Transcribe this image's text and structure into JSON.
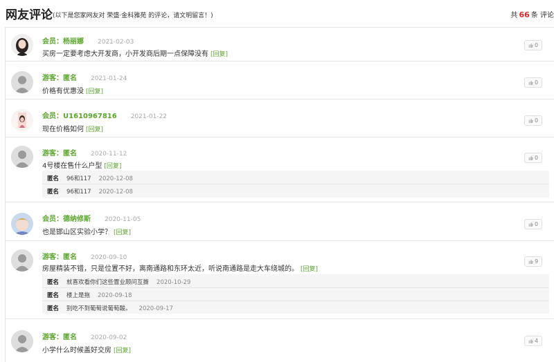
{
  "header": {
    "title": "网友评论",
    "subtitle": "(以下是您家网友对 荣盛·金科雅苑 的评论，请文明留言！)",
    "total_prefix": "共",
    "total_count": "66",
    "total_suffix": "条 评论"
  },
  "comments": [
    {
      "role": "会员：",
      "name": "杨丽娜",
      "date": "2021-02-03",
      "text": "买房一定要考虑大开发商，小开发商后期一点保障没有",
      "reply_label": "[回复]",
      "likes": "0",
      "avatar": "photo-female-avatar"
    },
    {
      "role": "游客：",
      "name": "匿名",
      "date": "2021-01-24",
      "text": "价格有优惠没",
      "reply_label": "[回复]",
      "likes": "0",
      "avatar": "default-user-avatar"
    },
    {
      "role": "会员：",
      "name": "U1610967816",
      "date": "2021-01-22",
      "text": "现在价格如何",
      "reply_label": "[回复]",
      "likes": "0",
      "avatar": "photo-avatar"
    },
    {
      "role": "游客：",
      "name": "匿名",
      "date": "2020-11-12",
      "text": "4号楼在售什么户型",
      "reply_label": "[回复]",
      "likes": "0",
      "avatar": "default-user-avatar",
      "replies": [
        {
          "name": "匿名",
          "text": "96和117",
          "date": "2020-12-08"
        },
        {
          "name": "匿名",
          "text": "96和117",
          "date": "2020-12-08"
        }
      ]
    },
    {
      "role": "会员：",
      "name": "德纳修斯",
      "date": "2020-11-05",
      "text": "也是邯山区实验小学？",
      "reply_label": "[回复]",
      "likes": "0",
      "avatar": "photo-avatar"
    },
    {
      "role": "游客：",
      "name": "匿名",
      "date": "2020-09-10",
      "text": "房屋精装不错，只是位置不好，离南通路和东环太近，听说南通路是走大车绕城的。",
      "reply_label": "[回复]",
      "likes": "9",
      "avatar": "default-user-avatar",
      "replies": [
        {
          "name": "匿名",
          "text": "就喜欢看你们这些置业顾问互撕",
          "date": "2020-10-29"
        },
        {
          "name": "匿名",
          "text": "楼上是拖",
          "date": "2020-09-18"
        },
        {
          "name": "匿名",
          "text": "别吃不到葡萄说葡萄酸。",
          "date": "2020-09-17"
        }
      ]
    },
    {
      "role": "游客：",
      "name": "匿名",
      "date": "2020-09-02",
      "text": "小学什么时候盖好交房",
      "reply_label": "[回复]",
      "likes": "4",
      "avatar": "default-user-avatar"
    }
  ],
  "icons": {
    "like": "thumbs-up-icon"
  },
  "colors": {
    "accent": "#5aa62c",
    "count": "#d62b2b"
  }
}
